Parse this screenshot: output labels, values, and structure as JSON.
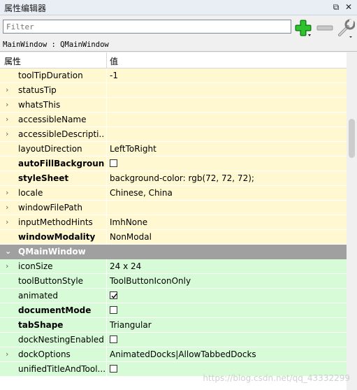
{
  "title": "属性编辑器",
  "title_buttons": {
    "float": "⧉",
    "close": "✕"
  },
  "filter": {
    "placeholder": "Filter"
  },
  "object_name": "MainWindow : QMainWindow",
  "header": {
    "property": "属性",
    "value": "值"
  },
  "colors": {
    "yellow": "#fff8d0",
    "green": "#d6fbd6",
    "group": "#a0a0a0"
  },
  "rows": [
    {
      "name": "toolTipDuration",
      "value": "-1",
      "expandable": false,
      "bold": false
    },
    {
      "name": "statusTip",
      "value": "",
      "expandable": true,
      "bold": false
    },
    {
      "name": "whatsThis",
      "value": "",
      "expandable": true,
      "bold": false
    },
    {
      "name": "accessibleName",
      "value": "",
      "expandable": true,
      "bold": false
    },
    {
      "name": "accessibleDescripti...",
      "value": "",
      "expandable": true,
      "bold": false
    },
    {
      "name": "layoutDirection",
      "value": "LeftToRight",
      "expandable": false,
      "bold": false
    },
    {
      "name": "autoFillBackground",
      "value": "",
      "checkbox": true,
      "checked": false,
      "expandable": false,
      "bold": true
    },
    {
      "name": "styleSheet",
      "value": "background-color: rgb(72, 72, 72);",
      "expandable": false,
      "bold": true
    },
    {
      "name": "locale",
      "value": "Chinese, China",
      "expandable": true,
      "bold": false
    },
    {
      "name": "windowFilePath",
      "value": "",
      "expandable": true,
      "bold": false
    },
    {
      "name": "inputMethodHints",
      "value": "ImhNone",
      "expandable": true,
      "bold": false
    },
    {
      "name": "windowModality",
      "value": "NonModal",
      "expandable": false,
      "bold": true
    }
  ],
  "group": {
    "name": "QMainWindow"
  },
  "group_rows": [
    {
      "name": "iconSize",
      "value": "24 x 24",
      "expandable": true,
      "bold": false
    },
    {
      "name": "toolButtonStyle",
      "value": "ToolButtonIconOnly",
      "expandable": false,
      "bold": false
    },
    {
      "name": "animated",
      "value": "",
      "checkbox": true,
      "checked": true,
      "expandable": false,
      "bold": false
    },
    {
      "name": "documentMode",
      "value": "",
      "checkbox": true,
      "checked": false,
      "expandable": false,
      "bold": true
    },
    {
      "name": "tabShape",
      "value": "Triangular",
      "expandable": false,
      "bold": true
    },
    {
      "name": "dockNestingEnabled",
      "value": "",
      "checkbox": true,
      "checked": false,
      "expandable": false,
      "bold": false
    },
    {
      "name": "dockOptions",
      "value": "AnimatedDocks|AllowTabbedDocks",
      "expandable": true,
      "bold": false
    },
    {
      "name": "unifiedTitleAndTool...",
      "value": "",
      "checkbox": true,
      "checked": false,
      "expandable": false,
      "bold": false
    }
  ],
  "watermark": "https://blog.csdn.net/qq_43332299"
}
